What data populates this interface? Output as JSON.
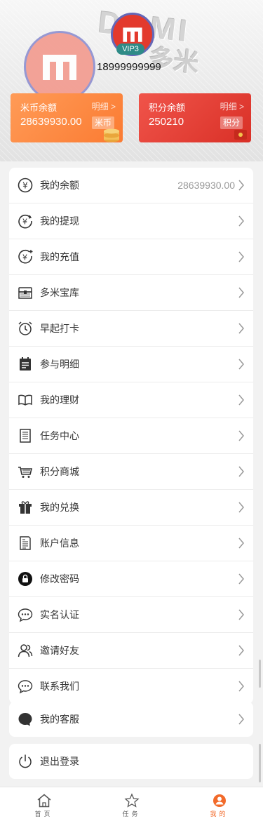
{
  "header": {
    "brand_text": "DOMI",
    "brand_cn": "多米",
    "vip": "VIP3",
    "phone": "18999999999"
  },
  "cards": {
    "coin": {
      "title": "米币余额",
      "detail": "明细 >",
      "value": "28639930.00",
      "tag": "米币"
    },
    "points": {
      "title": "积分余额",
      "detail": "明细 >",
      "value": "250210",
      "tag": "积分"
    }
  },
  "menu": {
    "items": [
      {
        "label": "我的余额",
        "value": "28639930.00",
        "icon": "yuan-circle-icon"
      },
      {
        "label": "我的提现",
        "icon": "withdraw-icon"
      },
      {
        "label": "我的充值",
        "icon": "recharge-icon"
      },
      {
        "label": "多米宝库",
        "icon": "treasure-chest-icon"
      },
      {
        "label": "早起打卡",
        "icon": "alarm-clock-icon"
      },
      {
        "label": "参与明细",
        "icon": "calendar-list-icon"
      },
      {
        "label": "我的理财",
        "icon": "open-book-icon"
      },
      {
        "label": "任务中心",
        "icon": "document-icon"
      },
      {
        "label": "积分商城",
        "icon": "shopping-cart-icon"
      },
      {
        "label": "我的兑换",
        "icon": "gift-box-icon"
      },
      {
        "label": "账户信息",
        "icon": "receipt-icon"
      },
      {
        "label": "修改密码",
        "icon": "lock-icon"
      },
      {
        "label": "实名认证",
        "icon": "chat-bubble-icon"
      },
      {
        "label": "邀请好友",
        "icon": "users-icon"
      },
      {
        "label": "联系我们",
        "icon": "chat-bubble-icon"
      }
    ]
  },
  "service": {
    "label": "我的客服",
    "icon": "headset-bubble-icon"
  },
  "logout": {
    "label": "退出登录",
    "icon": "power-icon"
  },
  "tabs": [
    {
      "label": "首页",
      "icon": "home-icon"
    },
    {
      "label": "任务",
      "icon": "star-icon"
    },
    {
      "label": "我的",
      "icon": "user-circle-icon",
      "active": true
    }
  ],
  "colors": {
    "accent": "#f26a2a",
    "coin_card": "#fb7b32",
    "points_card": "#d93027",
    "vip": "#2e8b87"
  }
}
